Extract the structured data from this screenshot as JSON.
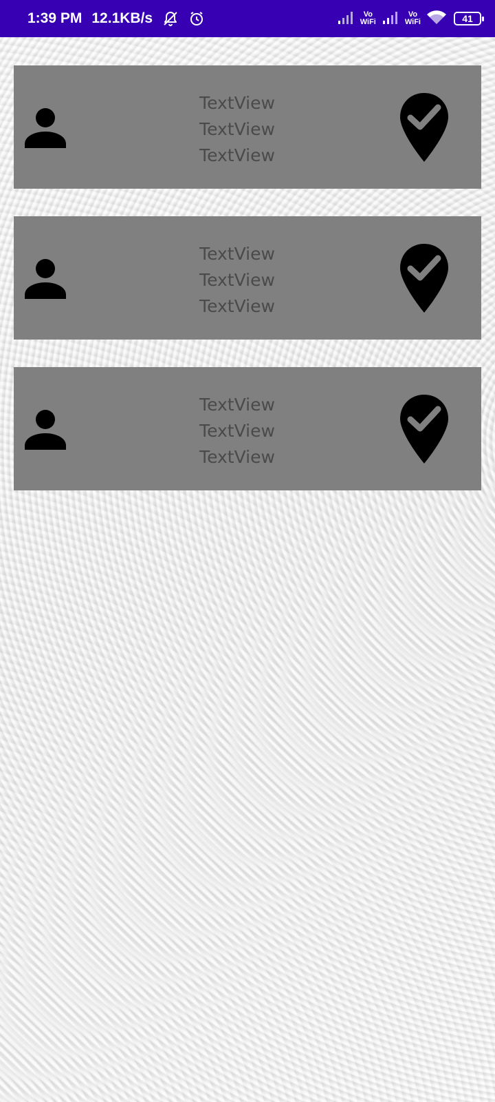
{
  "status_bar": {
    "time": "1:39 PM",
    "network_speed": "12.1KB/s",
    "vowifi_1_line1": "Vo",
    "vowifi_1_line2": "WiFi",
    "vowifi_2_line1": "Vo",
    "vowifi_2_line2": "WiFi",
    "battery_level": "41",
    "background_color": "#3700b3",
    "icons": [
      "bell-off-icon",
      "alarm-icon",
      "signal-icon",
      "signal-icon",
      "wifi-icon",
      "battery-icon"
    ]
  },
  "cards": [
    {
      "line1": "TextView",
      "line2": "TextView",
      "line3": "TextView",
      "icon_left": "person-icon",
      "icon_right": "location-check-icon"
    },
    {
      "line1": "TextView",
      "line2": "TextView",
      "line3": "TextView",
      "icon_left": "person-icon",
      "icon_right": "location-check-icon"
    },
    {
      "line1": "TextView",
      "line2": "TextView",
      "line3": "TextView",
      "icon_left": "person-icon",
      "icon_right": "location-check-icon"
    }
  ],
  "colors": {
    "card_background": "#808080",
    "text": "#4a4a4a",
    "icon": "#000000"
  }
}
